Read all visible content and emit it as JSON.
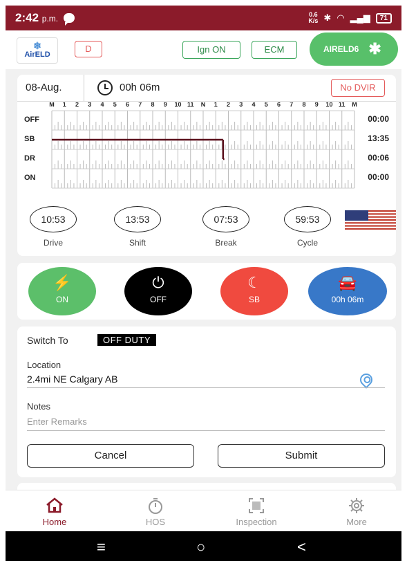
{
  "status_bar": {
    "time": "2:42",
    "ampm": "p.m.",
    "net_speed_top": "0.6",
    "net_speed_bottom": "K/s",
    "battery": "71"
  },
  "header": {
    "logo_text": "AirELD",
    "d_label": "D",
    "ign_label": "Ign ON",
    "ecm_label": "ECM",
    "device_label": "AIRELD6"
  },
  "hos": {
    "date": "08-Aug.",
    "duration": "00h 06m",
    "dvir_label": "No DVIR",
    "hour_labels": [
      "M",
      "1",
      "2",
      "3",
      "4",
      "5",
      "6",
      "7",
      "8",
      "9",
      "10",
      "11",
      "N",
      "1",
      "2",
      "3",
      "4",
      "5",
      "6",
      "7",
      "8",
      "9",
      "10",
      "11",
      "M"
    ],
    "rows": [
      {
        "label": "OFF",
        "total": "00:00"
      },
      {
        "label": "SB",
        "total": "13:35"
      },
      {
        "label": "DR",
        "total": "00:06"
      },
      {
        "label": "ON",
        "total": "00:00"
      }
    ],
    "log_segments": [
      {
        "status": "SB",
        "start_hour": 0,
        "end_hour": 13.58
      },
      {
        "status": "DR",
        "start_hour": 13.58,
        "end_hour": 13.68
      }
    ],
    "clocks": [
      {
        "value": "10:53",
        "label": "Drive"
      },
      {
        "value": "13:53",
        "label": "Shift"
      },
      {
        "value": "07:53",
        "label": "Break"
      },
      {
        "value": "59:53",
        "label": "Cycle"
      }
    ]
  },
  "status_buttons": [
    {
      "label": "ON",
      "icon": "lightning-icon",
      "color": "#5cbf6a"
    },
    {
      "label": "OFF",
      "icon": "power-icon",
      "color": "#000000"
    },
    {
      "label": "SB",
      "icon": "moon-icon",
      "color": "#f04a3f"
    },
    {
      "label": "00h 06m",
      "icon": "car-icon",
      "color": "#3878c8"
    }
  ],
  "switch": {
    "switch_to_label": "Switch To",
    "status": "OFF DUTY",
    "location_label": "Location",
    "location_value": "2.4mi NE Calgary AB",
    "notes_label": "Notes",
    "notes_placeholder": "Enter Remarks",
    "cancel_label": "Cancel",
    "submit_label": "Submit"
  },
  "nav": [
    {
      "label": "Home",
      "icon": "home-icon",
      "active": true
    },
    {
      "label": "HOS",
      "icon": "timer-icon",
      "active": false
    },
    {
      "label": "Inspection",
      "icon": "scan-icon",
      "active": false
    },
    {
      "label": "More",
      "icon": "gear-icon",
      "active": false
    }
  ]
}
